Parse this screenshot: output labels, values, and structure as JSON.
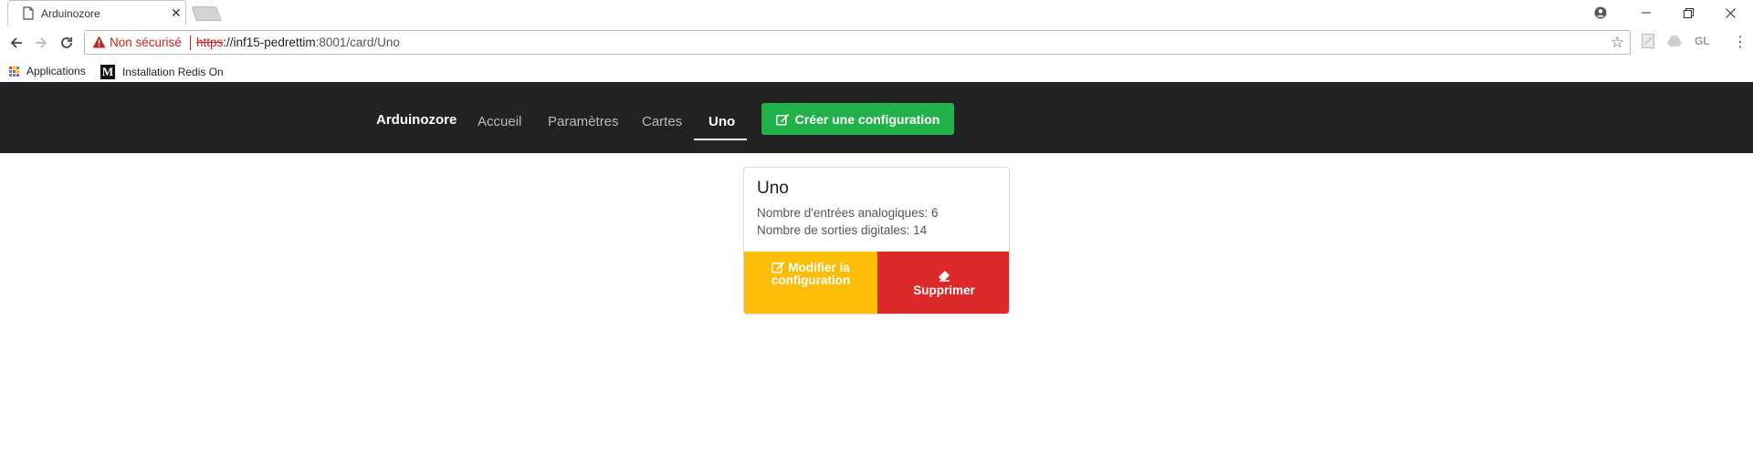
{
  "browser": {
    "tab_title": "Arduinozore",
    "tab_close": "✕",
    "security_label": "Non sécurisé",
    "url_scheme": "https",
    "url_host": "://inf15-pedrettim",
    "url_rest": ":8001/card/Uno",
    "profile_initials": "GL",
    "bookmarks": [
      {
        "label": "Applications"
      },
      {
        "label": "Installation Redis On"
      }
    ]
  },
  "nav": {
    "brand": "Arduinozore",
    "links": [
      "Accueil",
      "Paramètres",
      "Cartes",
      "Uno"
    ],
    "active_index": 3,
    "create_button": "Créer une configuration"
  },
  "card": {
    "title": "Uno",
    "analog_inputs": "Nombre d'entrées analogiques: 6",
    "digital_outputs": "Nombre de sorties digitales: 14",
    "edit_button": "Modifier la configuration",
    "delete_button": "Supprimer"
  },
  "colors": {
    "navbar_bg": "#212224",
    "create_green": "#21b24a",
    "edit_yellow": "#fbbd08",
    "delete_red": "#db2828",
    "insecure_red": "#c5221f"
  }
}
